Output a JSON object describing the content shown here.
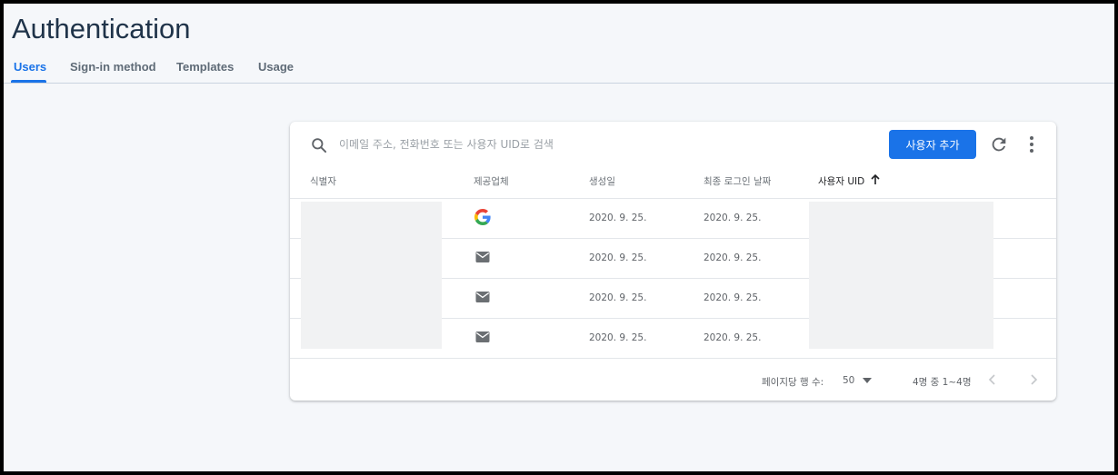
{
  "header": {
    "title": "Authentication"
  },
  "tabs": [
    {
      "label": "Users",
      "active": true
    },
    {
      "label": "Sign-in method",
      "active": false
    },
    {
      "label": "Templates",
      "active": false
    },
    {
      "label": "Usage",
      "active": false
    }
  ],
  "toolbar": {
    "search_placeholder": "이메일 주소, 전화번호 또는 사용자 UID로 검색",
    "add_user_label": "사용자 추가",
    "icons": [
      "search-icon",
      "refresh-icon",
      "more-vert-icon"
    ]
  },
  "table": {
    "columns": [
      "식별자",
      "제공업체",
      "생성일",
      "최종 로그인 날짜",
      "사용자 UID"
    ],
    "sorted_column": "사용자 UID",
    "sort_direction": "ascending",
    "rows": [
      {
        "provider": "google-icon",
        "created": "2020. 9. 25.",
        "last_login": "2020. 9. 25."
      },
      {
        "provider": "email-icon",
        "created": "2020. 9. 25.",
        "last_login": "2020. 9. 25."
      },
      {
        "provider": "email-icon",
        "created": "2020. 9. 25.",
        "last_login": "2020. 9. 25."
      },
      {
        "provider": "email-icon",
        "created": "2020. 9. 25.",
        "last_login": "2020. 9. 25."
      }
    ]
  },
  "pagination": {
    "rows_per_page_label": "페이지당 행 수:",
    "rows_per_page_value": "50",
    "range_text": "4명 중 1~4명"
  },
  "colors": {
    "accent": "#1a73e8",
    "title": "#1f3349",
    "background": "#f5f7fa"
  }
}
